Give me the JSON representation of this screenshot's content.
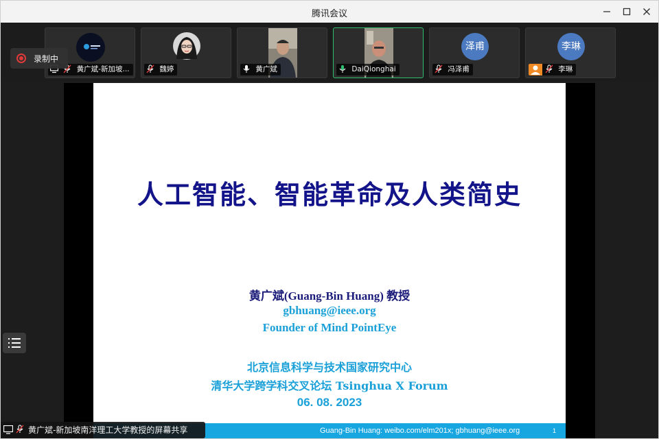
{
  "window": {
    "title": "腾讯会议"
  },
  "recording": {
    "label": "录制中"
  },
  "participants": [
    {
      "name": "黄广斌-新加坡...",
      "mic": "muted",
      "kind": "logo",
      "sharing": true
    },
    {
      "name": "魏婷",
      "mic": "muted",
      "kind": "portrait"
    },
    {
      "name": "黄广斌",
      "mic": "on",
      "kind": "video"
    },
    {
      "name": "DaiQionghai",
      "mic": "on",
      "kind": "video",
      "speaking": true
    },
    {
      "name": "冯泽甫",
      "mic": "muted",
      "kind": "initials",
      "initials": "泽甫"
    },
    {
      "name": "李琳",
      "mic": "muted",
      "kind": "initials",
      "initials": "李琳"
    }
  ],
  "slide": {
    "title": "人工智能、智能革命及人类简史",
    "author": "黄广斌(Guang-Bin Huang)  教授",
    "email": "gbhuang@ieee.org",
    "founder": "Founder of Mind PointEye",
    "center": "北京信息科学与技术国家研究中心",
    "forum": "清华大学跨学科交叉论坛  Tsinghua X Forum",
    "date": "06. 08. 2023",
    "footer": "Guang-Bin Huang: weibo.com/elm201x; gbhuang@ieee.org",
    "page": "1"
  },
  "share_label": "黄广斌-新加坡南洋理工大学教授的屏幕共享",
  "colors": {
    "accent": "#18a6e0",
    "title_navy": "#14148a",
    "speaking_border": "#2fbf71",
    "record_red": "#e03a3a"
  }
}
